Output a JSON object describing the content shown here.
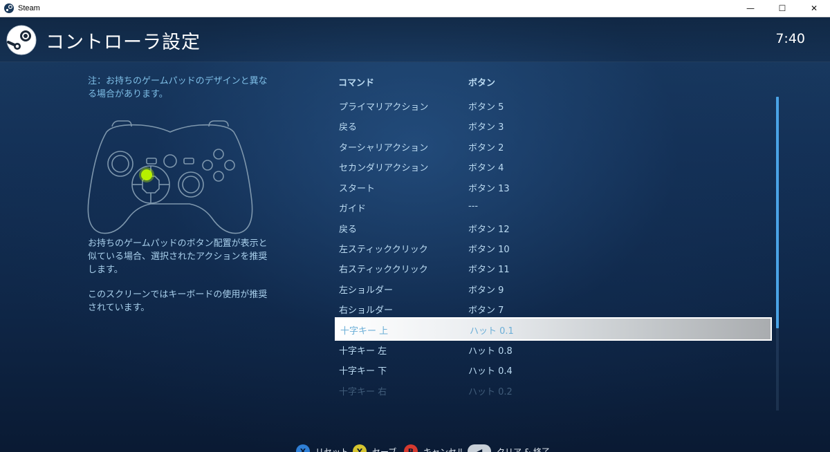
{
  "window": {
    "title": "Steam",
    "minimize": "—",
    "maximize": "☐",
    "close": "✕"
  },
  "header": {
    "title": "コントローラ設定",
    "clock": "7:40"
  },
  "left_panel": {
    "note": "注：お持ちのゲームパッドのデザインと異なる場合があります。",
    "description1": "お持ちのゲームパッドのボタン配置が表示と似ている場合、選択されたアクションを推奨します。",
    "description2": "このスクリーンではキーボードの使用が推奨されています。"
  },
  "list": {
    "column_command": "コマンド",
    "column_button": "ボタン",
    "rows": [
      {
        "command": "プライマリアクション",
        "button": "ボタン 5"
      },
      {
        "command": "戻る",
        "button": "ボタン 3"
      },
      {
        "command": "ターシャリアクション",
        "button": "ボタン 2"
      },
      {
        "command": "セカンダリアクション",
        "button": "ボタン 4"
      },
      {
        "command": "スタート",
        "button": "ボタン 13"
      },
      {
        "command": "ガイド",
        "button": "---"
      },
      {
        "command": "戻る",
        "button": "ボタン 12"
      },
      {
        "command": "左スティッククリック",
        "button": "ボタン 10"
      },
      {
        "command": "右スティッククリック",
        "button": "ボタン 11"
      },
      {
        "command": "左ショルダー",
        "button": "ボタン 9"
      },
      {
        "command": "右ショルダー",
        "button": "ボタン 7"
      },
      {
        "command": "十字キー 上",
        "button": "ハット 0.1"
      },
      {
        "command": "十字キー 左",
        "button": "ハット 0.8"
      },
      {
        "command": "十字キー 下",
        "button": "ハット 0.4"
      },
      {
        "command": "十字キー 右",
        "button": "ハット 0.2"
      }
    ]
  },
  "footer": {
    "reset": {
      "glyph": "X",
      "label": "リセット",
      "color": "#2f7fd6"
    },
    "save": {
      "glyph": "Y",
      "label": "セーブ",
      "color": "#d6c52f"
    },
    "cancel": {
      "glyph": "B",
      "label": "キャンセル",
      "color": "#d63a2f"
    },
    "clear_exit": {
      "glyph": "◀",
      "label": "クリア & 終了",
      "color": "#c8d0d8"
    }
  },
  "colors": {
    "accent": "#4aa3e6",
    "highlight_dot": "#c8ff00",
    "text": "#bcdcf3"
  }
}
